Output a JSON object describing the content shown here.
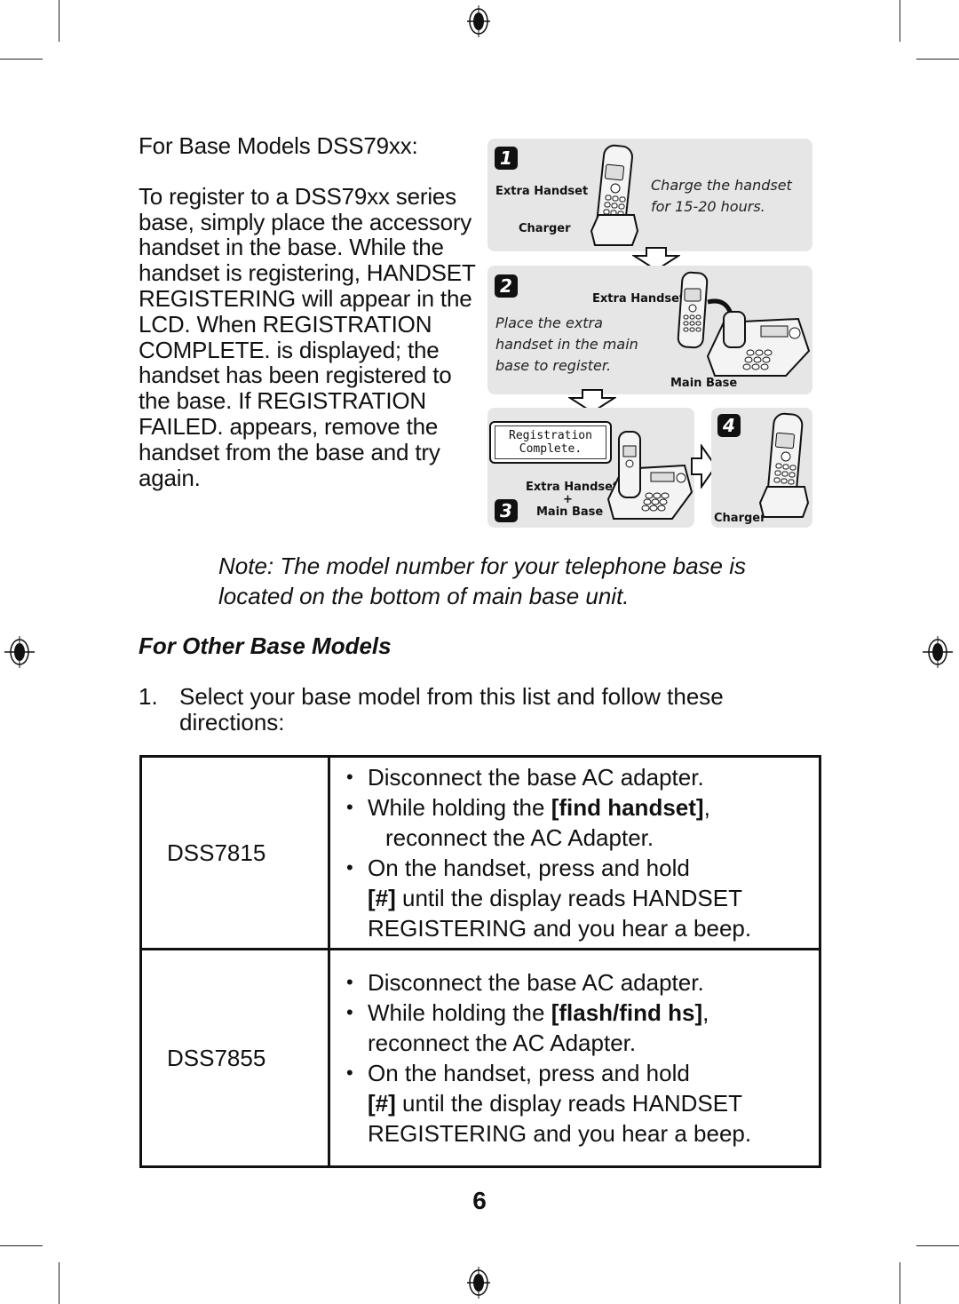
{
  "intro": {
    "heading": "For Base Models DSS79xx:",
    "paragraph": "To register to a DSS79xx series base, simply place the accessory handset in the base. While the handset is registering, HANDSET REGISTERING will appear in the LCD. When REGISTRATION COMPLETE. is displayed; the handset has been registered to the base. If REGISTRATION FAILED. appears, remove the handset from the base and try again."
  },
  "illustration": {
    "step1": {
      "number": "1",
      "label_handset": "Extra Handset",
      "label_charger": "Charger",
      "caption_line1": "Charge the handset",
      "caption_line2": "for 15-20 hours."
    },
    "step2": {
      "number": "2",
      "label_handset": "Extra Handset",
      "label_base": "Main Base",
      "caption_line1": "Place the extra",
      "caption_line2": "handset in the main",
      "caption_line3": "base to register."
    },
    "step3": {
      "number": "3",
      "lcd_line1": "Registration",
      "lcd_line2": "Complete.",
      "label_handset": "Extra Handset",
      "label_plus": "+",
      "label_base": "Main Base"
    },
    "step4": {
      "number": "4",
      "label_charger": "Charger"
    }
  },
  "note": {
    "line1": "Note: The model number for your telephone base is",
    "line2": "located on the bottom of main base unit."
  },
  "other_models": {
    "title": "For Other Base Models",
    "step_number": "1.",
    "step_text": "Select your base model from this list and follow these directions:",
    "rows": [
      {
        "model": "DSS7815",
        "b1": "Disconnect the base AC adapter.",
        "b2_pre": "While holding the ",
        "b2_key": "[find handset]",
        "b2_post": ",",
        "b2_cont": "reconnect the AC Adapter.",
        "b3": "On the handset, press and hold",
        "b3_key": "[#]",
        "b3_cont1": " until the display reads HANDSET",
        "b3_cont2": "REGISTERING and you hear a beep."
      },
      {
        "model": "DSS7855",
        "b1": "Disconnect the base AC adapter.",
        "b2_pre": "While holding the ",
        "b2_key": "[flash/find hs]",
        "b2_post": ",",
        "b2_cont": "reconnect the AC Adapter.",
        "b3": "On the handset, press and hold",
        "b3_key": "[#]",
        "b3_cont1": " until the display reads HANDSET",
        "b3_cont2": "REGISTERING and you hear a beep."
      }
    ]
  },
  "page_number": "6",
  "marks": {
    "icon": "registration-mark-icon"
  }
}
